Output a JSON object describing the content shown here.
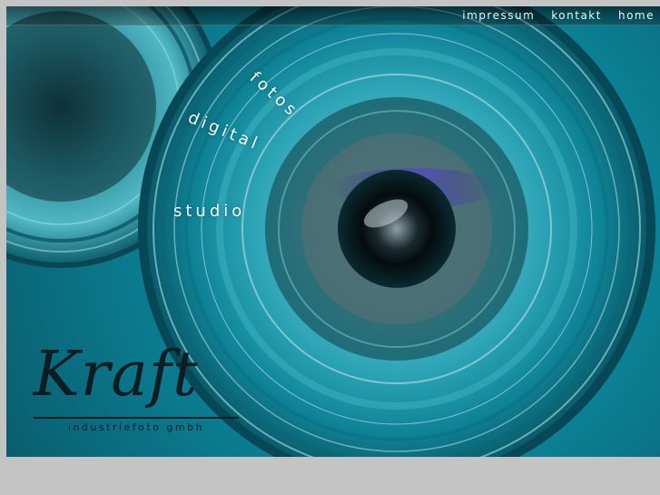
{
  "nav": {
    "items": [
      {
        "label": "impressum"
      },
      {
        "label": "kontakt"
      },
      {
        "label": "home"
      }
    ]
  },
  "hero": {
    "words": {
      "fotos": "fotos",
      "digital": "digital",
      "studio": "studio"
    }
  },
  "logo": {
    "wordmark": "Kraft",
    "tagline": "industriefoto gmbh"
  },
  "colors": {
    "page_background": "#c4c4c4",
    "lens_cyan": "#1ea1b5",
    "lens_dark": "#0a5d6e",
    "logo_ink": "#0b1c22",
    "nav_text": "#e8f6f8"
  }
}
